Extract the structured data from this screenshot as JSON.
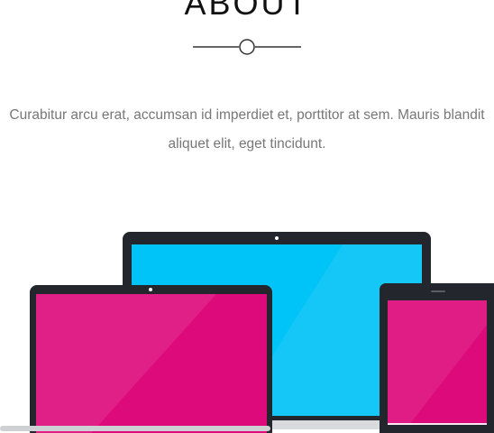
{
  "about": {
    "title": "ABOUT",
    "intro_line1": "Curabitur arcu erat, accumsan id imperdiet et, porttitor at sem. Mauris blandit",
    "intro_line2": "aliquet elit, eget tincidunt."
  },
  "illustration": {
    "devices": [
      "laptop-back",
      "laptop-front",
      "tablet"
    ],
    "colors": {
      "device_frame": "#24262e",
      "laptop_screen": "#00c3f7",
      "magenta_screen": "#dd0a7b",
      "highlight": "#ffffff",
      "divider": "#333333",
      "text": "#777777",
      "title": "#111111"
    }
  }
}
